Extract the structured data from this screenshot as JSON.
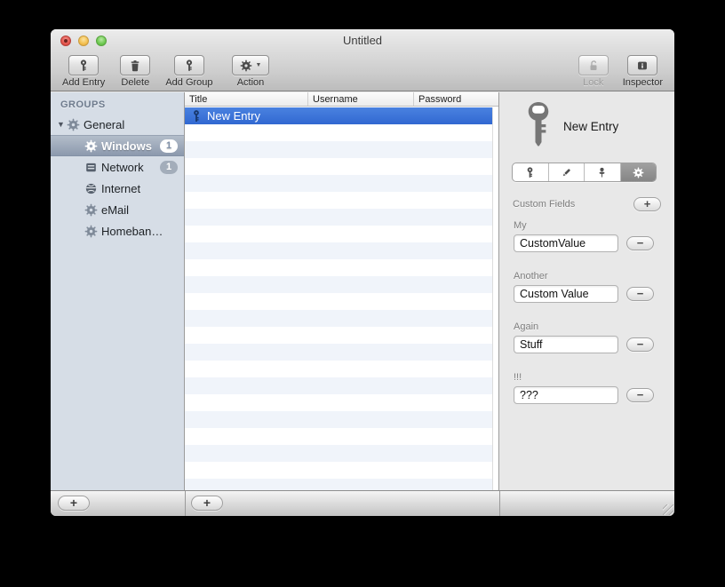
{
  "window": {
    "title": "Untitled"
  },
  "toolbar": {
    "add_entry": "Add Entry",
    "delete": "Delete",
    "add_group": "Add Group",
    "action": "Action",
    "lock": "Lock",
    "inspector": "Inspector"
  },
  "sidebar": {
    "header": "GROUPS",
    "items": [
      {
        "label": "General",
        "icon": "gear",
        "expanded": true,
        "level": 0
      },
      {
        "label": "Windows",
        "icon": "gear",
        "badge": "1",
        "selected": true,
        "level": 1
      },
      {
        "label": "Network",
        "icon": "server",
        "badge": "1",
        "level": 1
      },
      {
        "label": "Internet",
        "icon": "globe",
        "level": 1
      },
      {
        "label": "eMail",
        "icon": "gear",
        "level": 1
      },
      {
        "label": "Homeban…",
        "icon": "gear",
        "level": 1
      }
    ],
    "add_button": "+"
  },
  "table": {
    "columns": [
      "Title",
      "Username",
      "Password"
    ],
    "rows": [
      {
        "title": "New Entry",
        "username": "",
        "password": "",
        "icon": "key",
        "selected": true
      }
    ],
    "add_button": "+"
  },
  "inspector_panel": {
    "entry_title": "New Entry",
    "tabs": [
      {
        "icon": "key"
      },
      {
        "icon": "pencil"
      },
      {
        "icon": "pin"
      },
      {
        "icon": "gear",
        "selected": true
      }
    ],
    "section_title": "Custom Fields",
    "add_button": "+",
    "remove_button": "−",
    "fields": [
      {
        "label": "My",
        "value": "CustomValue"
      },
      {
        "label": "Another",
        "value": "Custom Value"
      },
      {
        "label": "Again",
        "value": "Stuff"
      },
      {
        "label": "!!!",
        "value": "???"
      }
    ]
  },
  "colors": {
    "selection_blue": "#3a74d8",
    "sidebar_selection": "#8c99ad",
    "sidebar_bg": "#d6dde6",
    "inspector_bg": "#e8e8e8"
  }
}
